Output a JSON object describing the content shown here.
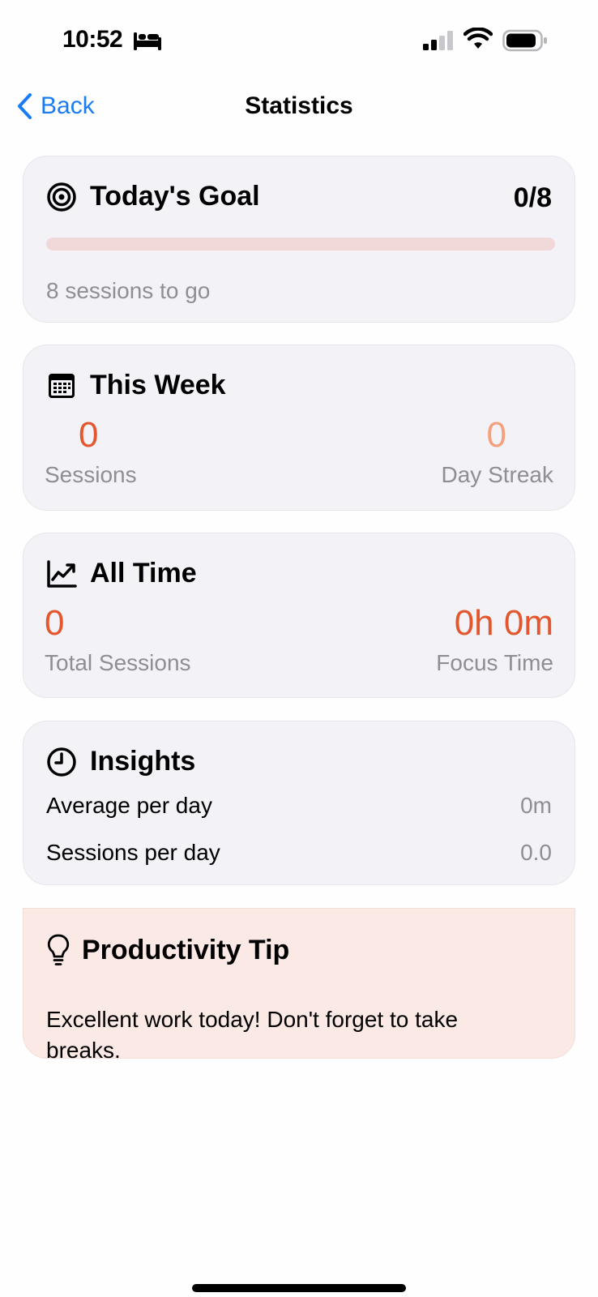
{
  "status_bar": {
    "time": "10:52"
  },
  "nav": {
    "back_label": "Back",
    "title": "Statistics"
  },
  "todays_goal": {
    "title": "Today's Goal",
    "value": "0/8",
    "progress_fraction": 0,
    "subtitle": "8 sessions to go"
  },
  "this_week": {
    "title": "This Week",
    "sessions_value": "0",
    "sessions_label": "Sessions",
    "streak_value": "0",
    "streak_label": "Day Streak"
  },
  "all_time": {
    "title": "All Time",
    "total_value": "0",
    "total_label": "Total Sessions",
    "focus_value": "0h 0m",
    "focus_label": "Focus Time"
  },
  "insights": {
    "title": "Insights",
    "rows": [
      {
        "label": "Average per day",
        "value": "0m"
      },
      {
        "label": "Sessions per day",
        "value": "0.0"
      }
    ]
  },
  "tip": {
    "title": "Productivity Tip",
    "text": "Excellent work today! Don't forget to take breaks."
  },
  "colors": {
    "accent": "#e4572e",
    "accent_light": "#f4a07a",
    "link": "#1a7cf2",
    "card_bg": "#f2f2f7",
    "tip_bg": "#fbe9e5"
  }
}
